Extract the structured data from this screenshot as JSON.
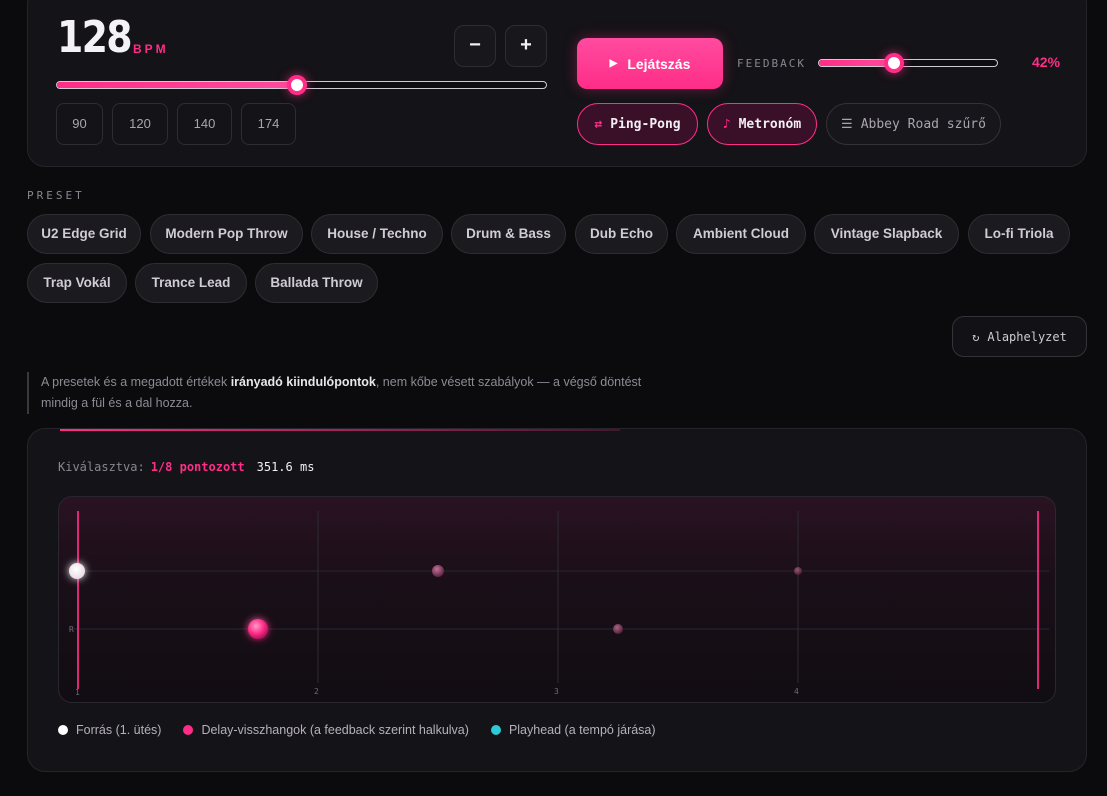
{
  "tempo": {
    "value": "128",
    "unit": "BPM",
    "minus_label": "−",
    "plus_label": "+",
    "slider_fraction": 0.49,
    "presets": [
      "90",
      "120",
      "140",
      "174"
    ]
  },
  "transport": {
    "play_icon": "play-icon",
    "play_label": "Lejátszás",
    "feedback_label": "FEEDBACK",
    "feedback_value": "42%",
    "feedback_fraction": 0.42
  },
  "toggles": [
    {
      "icon": "⇄",
      "label": "Ping-Pong",
      "active": true
    },
    {
      "icon": "♪",
      "label": "Metronóm",
      "active": true
    },
    {
      "icon": "☰",
      "label": "Abbey Road szűrő",
      "active": false
    }
  ],
  "presets": {
    "section_label": "PRESET",
    "row1": [
      "U2 Edge Grid",
      "Modern Pop Throw",
      "House / Techno",
      "Drum & Bass",
      "Dub Echo",
      "Ambient Cloud",
      "Vintage Slapback",
      "Lo-fi Triola"
    ],
    "row2": [
      "Trap Vokál",
      "Trance Lead",
      "Ballada Throw"
    ],
    "reset_icon": "↻",
    "reset_label": "Alaphelyzet"
  },
  "note": {
    "prefix": "A presetek és a megadott értékek ",
    "bold": "irányadó kiindulópontok",
    "suffix": ", nem kőbe vésett szabályok — a végső döntést mindig a fül és a dal hozza."
  },
  "visualizer": {
    "selected_label": "Kiválasztva:",
    "selected_value": "1/8 pontozott",
    "selected_ms": "351.6 ms",
    "beat_labels": [
      "1",
      "2",
      "3",
      "4"
    ],
    "lane_label": "R",
    "colors": {
      "source": "#ffffff",
      "delay": "#ff2d87",
      "playhead": "#2ec9d6"
    },
    "legend": [
      {
        "label": "Forrás (1. ütés)",
        "color": "#ffffff"
      },
      {
        "label": "Delay-visszhangok (a feedback szerint halkulva)",
        "color": "#ff2d87"
      },
      {
        "label": "Playhead (a tempó járása)",
        "color": "#2ec9d6"
      }
    ]
  }
}
